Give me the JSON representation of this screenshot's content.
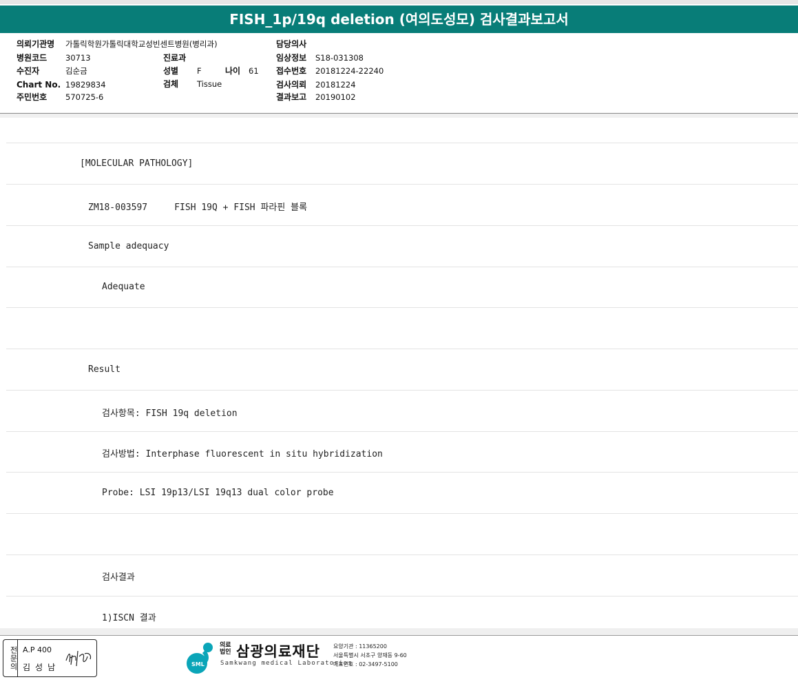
{
  "report": {
    "title": "FISH_1p/19q deletion (여의도성모) 검사결과보고서"
  },
  "header": {
    "institution_label": "의뢰기관명",
    "institution_value": "가톨릭학원가톨릭대학교성빈센트병원(병리과)",
    "hospital_code_label": "병원코드",
    "hospital_code_value": "30713",
    "patient_label": "수진자",
    "patient_value": "김순금",
    "chart_label": "Chart No.",
    "chart_value": "19829834",
    "resident_label": "주민번호",
    "resident_value": "570725-6",
    "dept_label": "진료과",
    "dept_value": "",
    "sex_label": "성별",
    "sex_value": "F",
    "age_label": "나이",
    "age_value": "61",
    "specimen_label": "검체",
    "specimen_value": "Tissue",
    "doctor_label": "담당의사",
    "doctor_value": "",
    "clinical_label": "임상정보",
    "clinical_value": "S18-031308",
    "receipt_label": "접수번호",
    "receipt_value": "20181224-22240",
    "request_label": "검사의뢰",
    "request_value": "20181224",
    "result_date_label": "결과보고",
    "result_date_value": "20190102"
  },
  "body": {
    "lines": [
      "[MOLECULAR PATHOLOGY]",
      "ZM18-003597     FISH 19Q + FISH 파라핀 블록",
      "Sample adequacy",
      "Adequate",
      "",
      "Result",
      "검사항목: FISH 19q deletion",
      "검사방법: Interphase fluorescent in situ hybridization",
      "Probe: LSI 19p13/LSI 19q13 dual color probe",
      "",
      "검사결과",
      "1)ISCN 결과"
    ]
  },
  "footer": {
    "stamp_label": "전문의",
    "stamp_ap": "A.P 400",
    "stamp_name": "김성남",
    "org_small": "의료\n법인",
    "org_name": "삼광의료재단",
    "org_en": "Samkwang medical Laboratories",
    "logo_text": "SML",
    "info1": "요양기관 : 11365200",
    "info2": "서울특별시 서초구 양재동 9-60",
    "info3": "대표번호 : 02-3497-5100",
    "brand_color": "#0aa5b8",
    "title_color": "#087d78"
  }
}
